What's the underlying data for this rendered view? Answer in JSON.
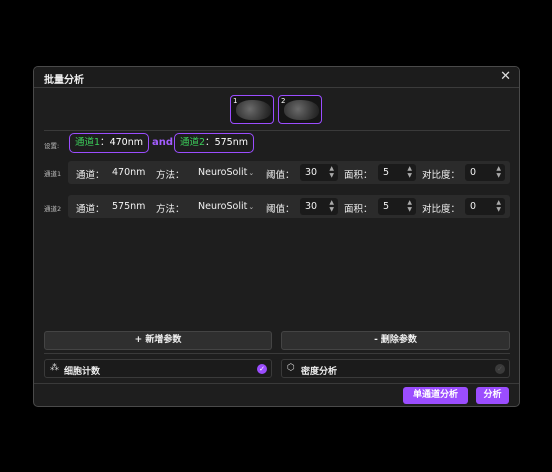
{
  "dialog": {
    "title": "批量分析",
    "close_icon": "✕"
  },
  "thumbnails": [
    {
      "index": "1"
    },
    {
      "index": "2"
    }
  ],
  "settings": {
    "label": "设置:",
    "channel1": {
      "name": "通道1",
      "sep": "：",
      "value": "470nm"
    },
    "and": "and",
    "channel2": {
      "name": "通道2",
      "sep": "：",
      "value": "575nm"
    }
  },
  "channels": [
    {
      "label": "通道1",
      "channel_key": "通道：",
      "channel_value": "470nm",
      "method_key": "方法：",
      "method_value": "NeuroSolit",
      "threshold_key": "阈值：",
      "threshold_value": "30",
      "area_key": "面积：",
      "area_value": "5",
      "contrast_key": "对比度：",
      "contrast_value": "0"
    },
    {
      "label": "通道2",
      "channel_key": "通道：",
      "channel_value": "575nm",
      "method_key": "方法：",
      "method_value": "NeuroSolit",
      "threshold_key": "阈值：",
      "threshold_value": "30",
      "area_key": "面积：",
      "area_value": "5",
      "contrast_key": "对比度：",
      "contrast_value": "0"
    }
  ],
  "buttons": {
    "add": "+ 新增参数",
    "remove": "- 删除参数"
  },
  "options": {
    "cell_count": {
      "label": "细胞计数",
      "checked": true
    },
    "density": {
      "label": "密度分析",
      "checked": false
    }
  },
  "footer": {
    "single_channel": "单通道分析",
    "analyze": "分析"
  },
  "colors": {
    "accent": "#9b4dff",
    "channel_name": "#3ccf5a",
    "background": "#1e1e1e"
  }
}
